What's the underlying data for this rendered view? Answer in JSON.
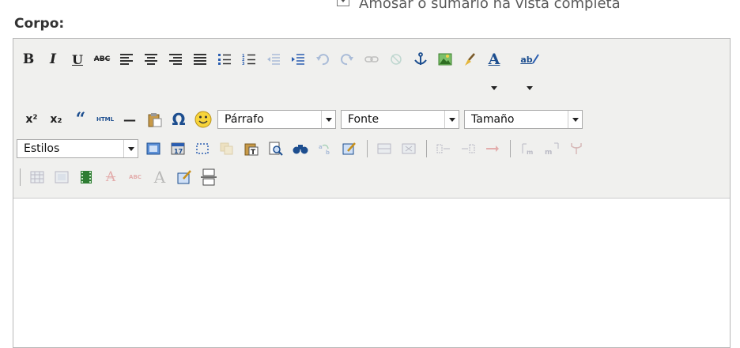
{
  "top_option": {
    "label": "Amosar o sumario na vista completa"
  },
  "field": {
    "label": "Corpo:"
  },
  "toolbar": {
    "bold": "B",
    "italic": "I",
    "underline": "U",
    "strike": "ABC",
    "html": "HTML",
    "omega": "Ω",
    "quote": "“",
    "sup_x": "x²",
    "sub_x": "x₂",
    "format_select": "Párrafo",
    "font_select": "Fonte",
    "size_select": "Tamaño",
    "styles_select": "Estilos",
    "hr": "—",
    "font_color_letter": "A",
    "highlight_letter": "ab",
    "text_a": "A"
  },
  "colors": {
    "toolbar_bg": "#f0f0ee",
    "border": "#b8b8b8",
    "accent_blue": "#2a5db0"
  }
}
